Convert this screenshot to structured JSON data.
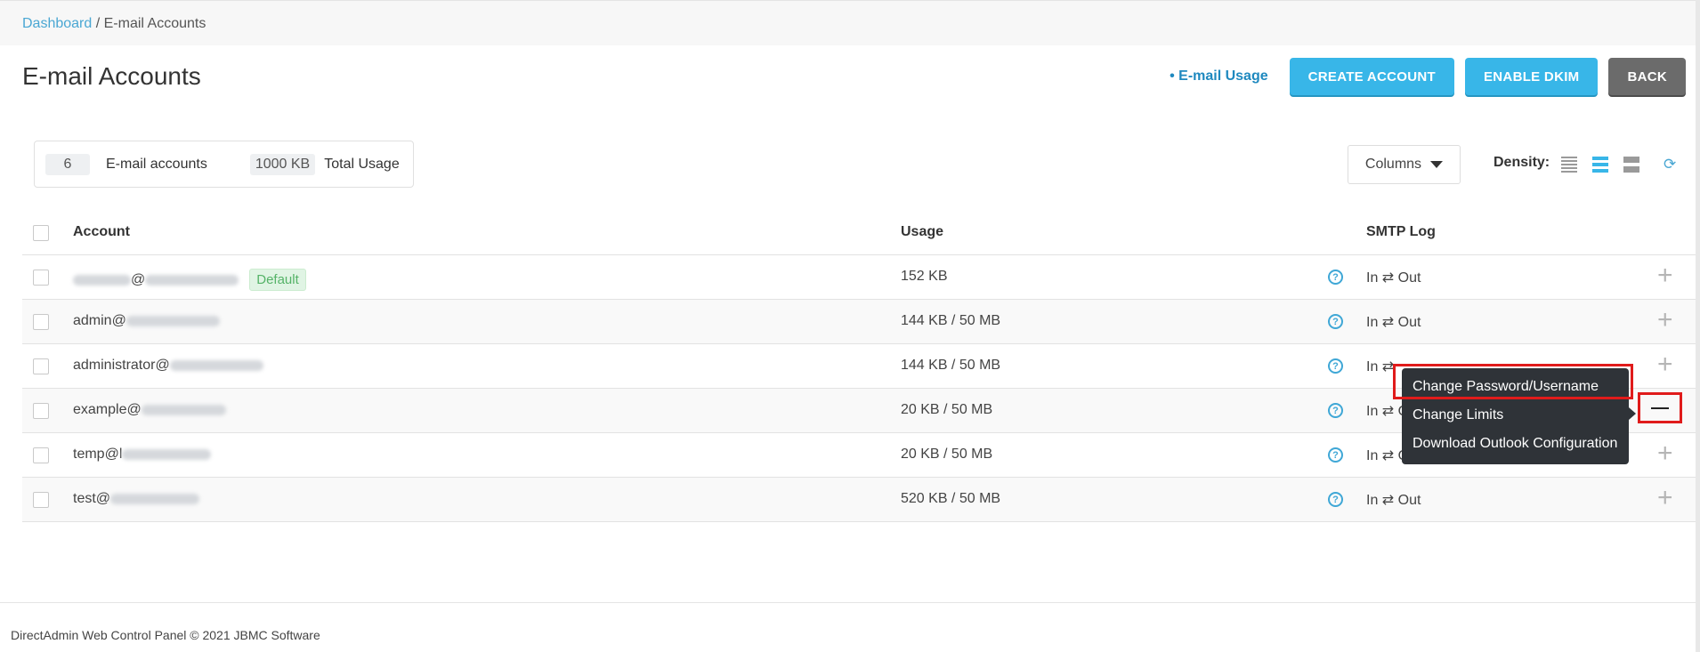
{
  "breadcrumb": {
    "home": "Dashboard",
    "separator": " / ",
    "current": "E-mail Accounts"
  },
  "page": {
    "title": "E-mail Accounts"
  },
  "actions": {
    "usage_link": "• E-mail Usage",
    "create": "CREATE ACCOUNT",
    "dkim": "ENABLE DKIM",
    "back": "BACK"
  },
  "summary": {
    "count": "6",
    "count_label": "E-mail accounts",
    "size": "1000 KB",
    "size_label": "Total Usage"
  },
  "toolbar": {
    "columns_label": "Columns",
    "density_label": "Density:",
    "density_selected": "normal"
  },
  "table": {
    "headers": {
      "account": "Account",
      "usage": "Usage",
      "smtp": "SMTP Log"
    },
    "rows": [
      {
        "user": "",
        "at": "@",
        "usage": "152 KB",
        "smtp": "In ⇄ Out",
        "badge": "Default"
      },
      {
        "user": "admin",
        "at": "@",
        "usage": "144 KB / 50 MB",
        "smtp": "In ⇄ Out"
      },
      {
        "user": "administrator",
        "at": "@",
        "usage": "144 KB / 50 MB",
        "smtp": "In ⇄"
      },
      {
        "user": "example",
        "at": "@",
        "usage": "20 KB / 50 MB",
        "smtp": "In ⇄ O"
      },
      {
        "user": "temp",
        "at": "@l",
        "usage": "20 KB / 50 MB",
        "smtp": "In ⇄ Out"
      },
      {
        "user": "test",
        "at": "@",
        "usage": "520 KB / 50 MB",
        "smtp": "In ⇄ Out"
      }
    ]
  },
  "context_menu": {
    "items": [
      "Change Password/Username",
      "Change Limits",
      "Download Outlook Configuration"
    ]
  },
  "footer": {
    "text": "DirectAdmin Web Control Panel © 2021 JBMC Software"
  },
  "colors": {
    "accent": "#38b6e8",
    "link": "#1f89bf",
    "highlight": "#e01b1b"
  }
}
